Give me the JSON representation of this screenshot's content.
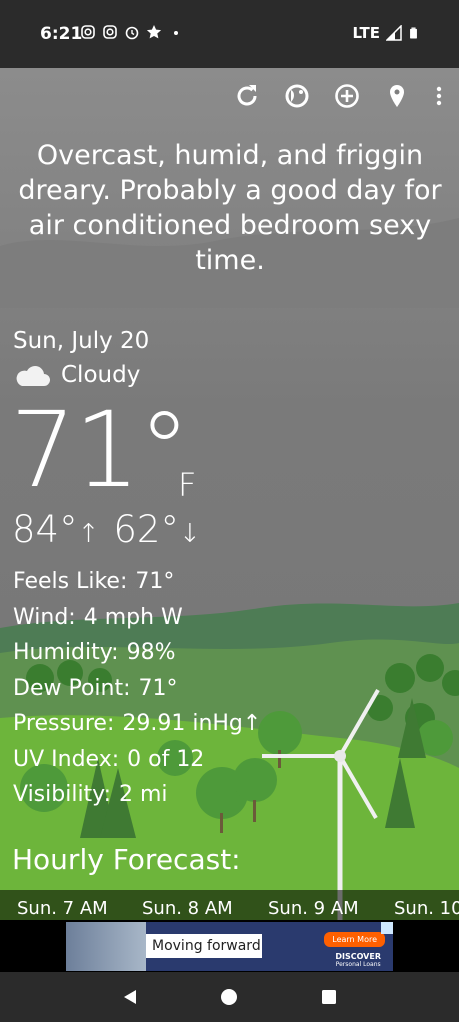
{
  "status_bar": {
    "time": "6:21",
    "network": "LTE",
    "left_icons": [
      "instagram-icon",
      "instagram-icon",
      "alarm-icon",
      "star-icon",
      "dot-icon"
    ],
    "right_icons": [
      "signal-icon",
      "battery-icon"
    ]
  },
  "toolbar": {
    "icons": [
      "refresh-icon",
      "theme-icon",
      "add-location-icon",
      "location-pin-icon",
      "more-vert-icon"
    ]
  },
  "tagline": "Overcast, humid, and friggin dreary. Probably a good day for air conditioned bedroom sexy time.",
  "current": {
    "date": "Sun, July 20",
    "condition": "Cloudy",
    "condition_icon": "cloud-icon",
    "temperature": "71°",
    "unit": "F",
    "high": "84°",
    "low": "62°"
  },
  "details": [
    {
      "label": "Feels Like:",
      "value": "71°"
    },
    {
      "label": "Wind:",
      "value": "4 mph W"
    },
    {
      "label": "Humidity:",
      "value": "98%"
    },
    {
      "label": "Dew Point:",
      "value": "71°"
    },
    {
      "label": "Pressure:",
      "value": "29.91 inHg↑"
    },
    {
      "label": "UV Index:",
      "value": "0 of 12"
    },
    {
      "label": "Visibility:",
      "value": "2 mi"
    }
  ],
  "hourly": {
    "title": "Hourly Forecast:",
    "hours": [
      "Sun. 7 AM",
      "Sun. 8 AM",
      "Sun. 9 AM",
      "Sun. 10"
    ]
  },
  "ad": {
    "text": "Moving forward",
    "cta": "Learn More",
    "brand": "DISCOVER",
    "brand_sub": "Personal Loans"
  },
  "nav": {
    "icons": [
      "back-icon",
      "home-icon",
      "recents-icon"
    ]
  },
  "colors": {
    "sky": "#8d8d8d",
    "hills": "#5a8a5a",
    "grass": "#6fb83c",
    "status_bar": "#2b2b2b"
  }
}
